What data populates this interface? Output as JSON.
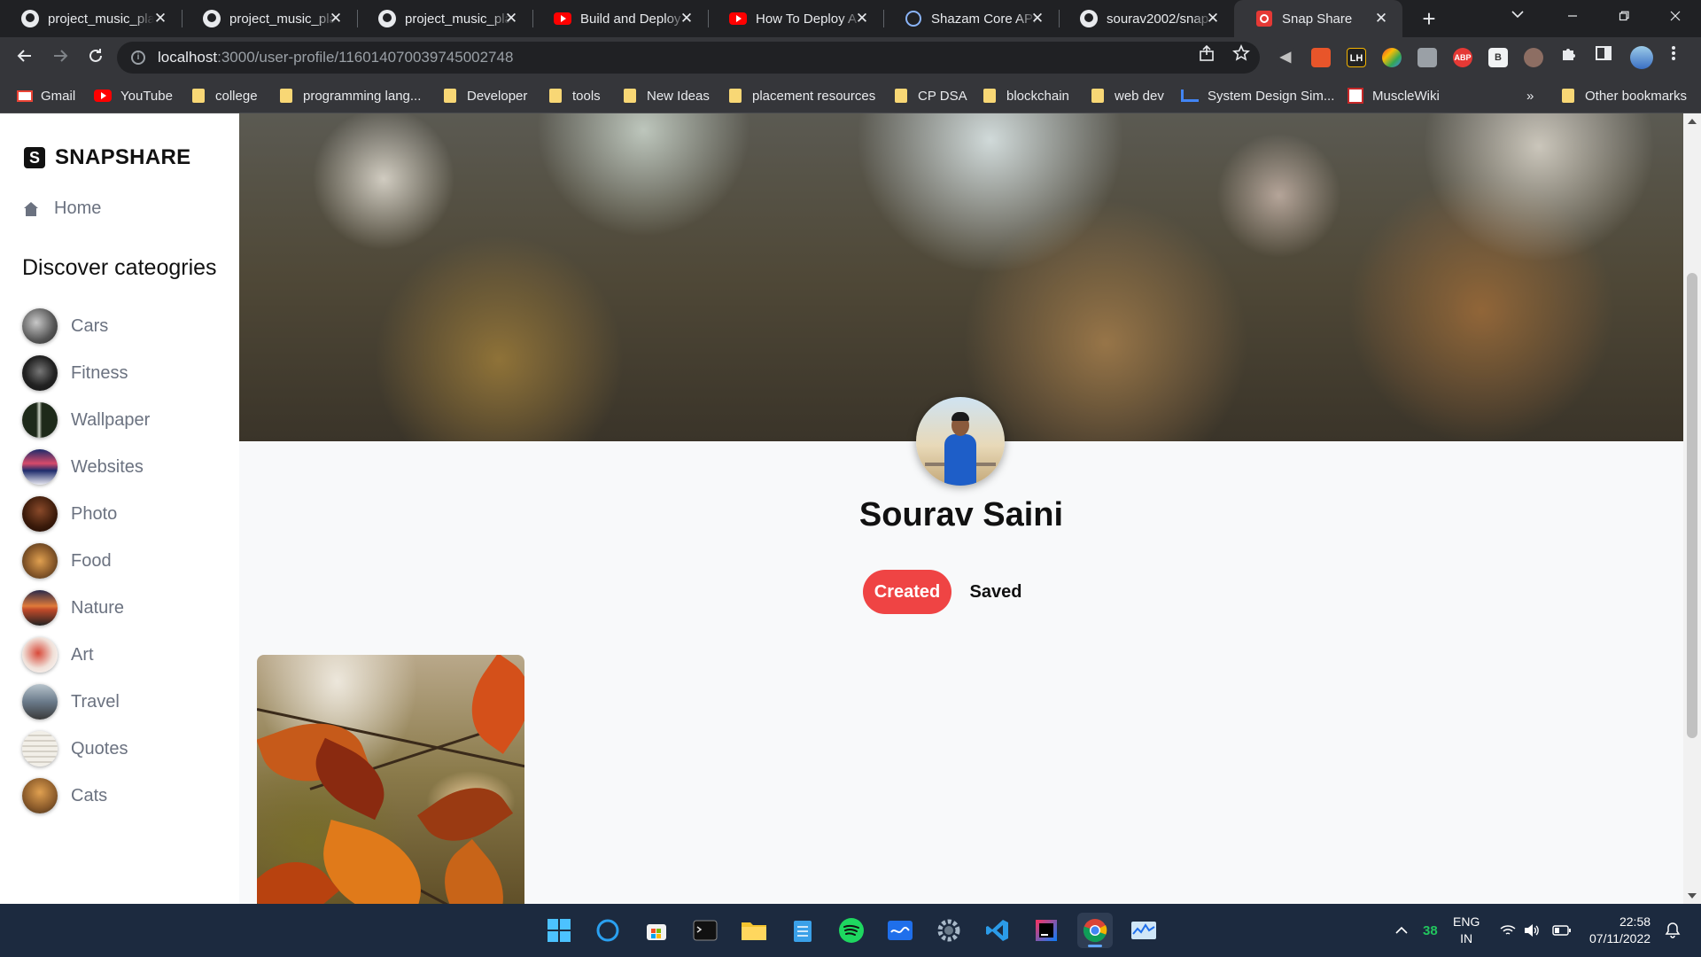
{
  "browser": {
    "tabs": [
      {
        "title": "project_music_pla",
        "icon": "github-icon"
      },
      {
        "title": "project_music_pla",
        "icon": "github-icon"
      },
      {
        "title": "project_music_pla",
        "icon": "github-icon"
      },
      {
        "title": "Build and Deploy",
        "icon": "youtube-icon"
      },
      {
        "title": "How To Deploy A",
        "icon": "youtube-icon"
      },
      {
        "title": "Shazam Core API",
        "icon": "rapidapi-icon"
      },
      {
        "title": "sourav2002/snap",
        "icon": "github-icon"
      },
      {
        "title": "Snap Share",
        "icon": "snapshare-icon"
      }
    ],
    "close_glyph": "✕",
    "new_tab_glyph": "+",
    "url_host": "localhost",
    "url_path": ":3000/user-profile/116014070039745002748",
    "bookmarks": [
      {
        "label": "Gmail",
        "icon": "gmail-icon"
      },
      {
        "label": "YouTube",
        "icon": "youtube-icon"
      },
      {
        "label": "college",
        "icon": "folder-icon"
      },
      {
        "label": "programming lang...",
        "icon": "folder-icon"
      },
      {
        "label": "Developer",
        "icon": "folder-icon"
      },
      {
        "label": "tools",
        "icon": "folder-icon"
      },
      {
        "label": "New Ideas",
        "icon": "folder-icon"
      },
      {
        "label": "placement resources",
        "icon": "folder-icon"
      },
      {
        "label": "CP DSA",
        "icon": "folder-icon"
      },
      {
        "label": "blockchain",
        "icon": "folder-icon"
      },
      {
        "label": "web dev",
        "icon": "folder-icon"
      },
      {
        "label": "System Design Sim...",
        "icon": "system-design-icon"
      },
      {
        "label": "MuscleWiki",
        "icon": "musclewiki-icon"
      }
    ],
    "bookmarks_overflow": "»",
    "other_bookmarks": "Other bookmarks",
    "extensions": [
      "LH",
      "ABP",
      "B"
    ]
  },
  "app": {
    "brand_letter": "S",
    "brand_name": "SNAPSHARE",
    "home_label": "Home",
    "categories_heading": "Discover cateogries",
    "categories": [
      {
        "name": "Cars",
        "color": "#6b6b6b"
      },
      {
        "name": "Fitness",
        "color": "#2b2b2b"
      },
      {
        "name": "Wallpaper",
        "color": "#2f3b2a"
      },
      {
        "name": "Websites",
        "color": "#2a3d7a"
      },
      {
        "name": "Photo",
        "color": "#4a2a1a"
      },
      {
        "name": "Food",
        "color": "#8a5a2a"
      },
      {
        "name": "Nature",
        "color": "#c0703a"
      },
      {
        "name": "Art",
        "color": "#d84a3a"
      },
      {
        "name": "Travel",
        "color": "#6a7a8a"
      },
      {
        "name": "Quotes",
        "color": "#e8e4dc"
      },
      {
        "name": "Cats",
        "color": "#b07a3a"
      }
    ]
  },
  "profile": {
    "name": "Sourav Saini",
    "created_label": "Created",
    "saved_label": "Saved",
    "accent": "#ef4444"
  },
  "taskbar": {
    "tray_badge": "38",
    "language": "ENG",
    "region": "IN",
    "time": "22:58",
    "date": "07/11/2022"
  }
}
